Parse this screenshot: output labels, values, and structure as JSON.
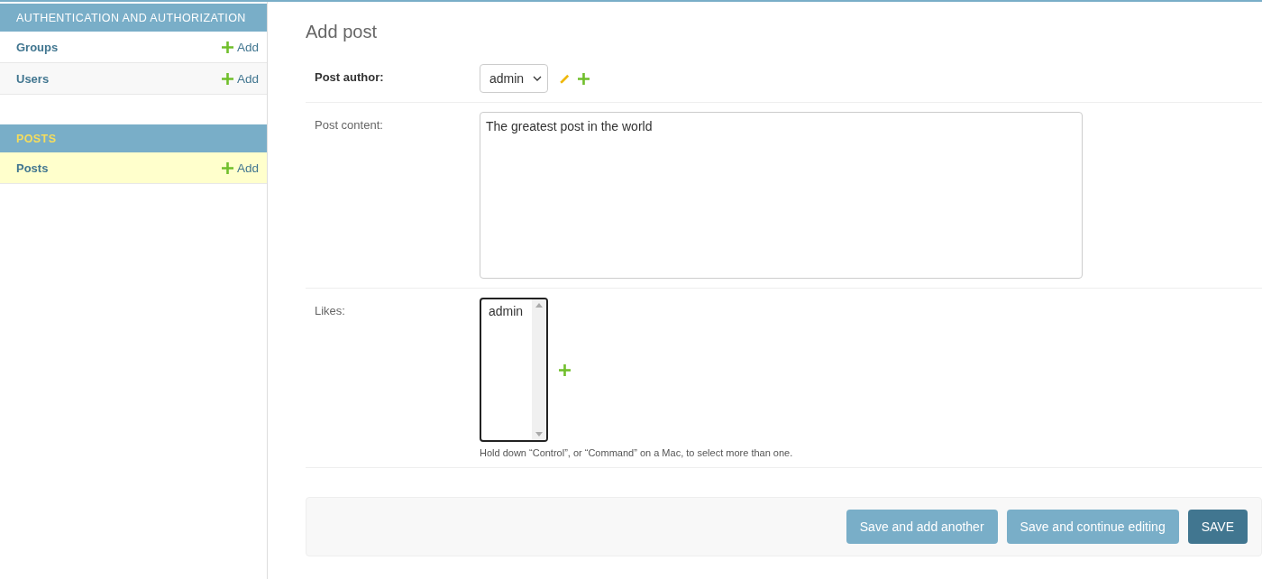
{
  "sidebar": {
    "modules": [
      {
        "caption": "AUTHENTICATION AND AUTHORIZATION",
        "selected": false,
        "items": [
          {
            "name": "Groups",
            "add": "Add",
            "selected": false
          },
          {
            "name": "Users",
            "add": "Add",
            "selected": false
          }
        ]
      },
      {
        "caption": "POSTS",
        "selected": true,
        "items": [
          {
            "name": "Posts",
            "add": "Add",
            "selected": true
          }
        ]
      }
    ]
  },
  "page_title": "Add post",
  "fields": [
    {
      "kind": "select",
      "label": "Post author:",
      "required": true,
      "value": "admin",
      "edit_icon": true,
      "add_icon": true
    },
    {
      "kind": "textarea",
      "label": "Post content:",
      "required": false,
      "value": "The greatest post in the world"
    },
    {
      "kind": "multiselect",
      "label": "Likes:",
      "required": false,
      "options": [
        "admin"
      ],
      "add_icon": true,
      "help": "Hold down “Control”, or “Command” on a Mac, to select more than one."
    }
  ],
  "buttons": [
    {
      "label": "Save and add another",
      "kind": "secondary"
    },
    {
      "label": "Save and continue editing",
      "kind": "secondary"
    },
    {
      "label": "SAVE",
      "kind": "primary"
    }
  ]
}
